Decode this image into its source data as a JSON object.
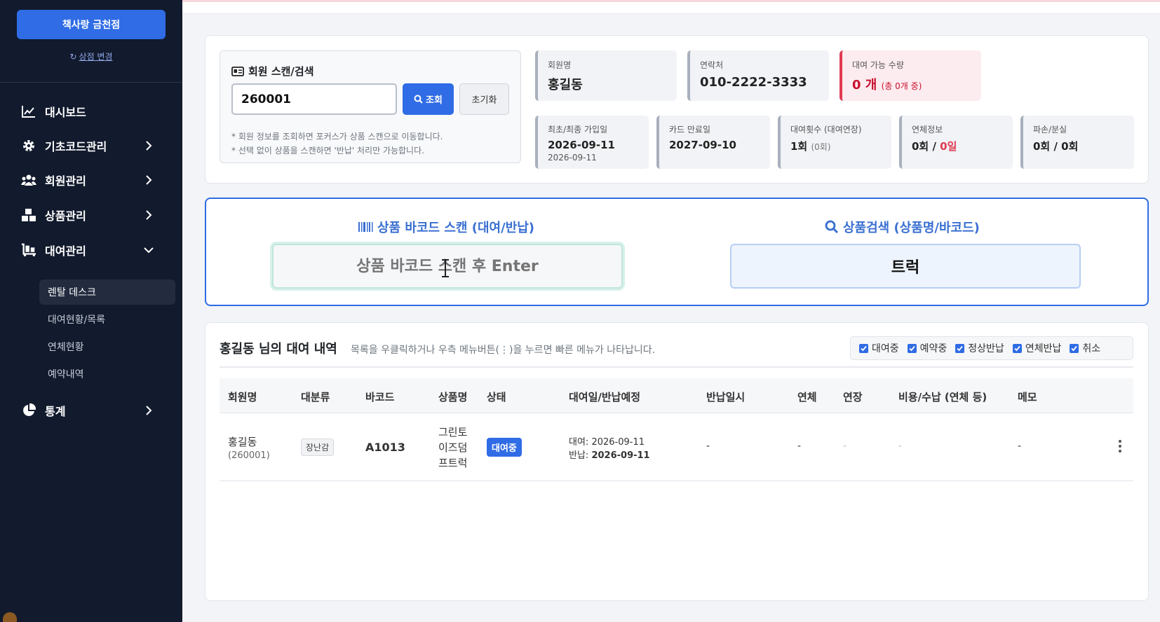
{
  "sidebar": {
    "store_button": "책사랑 금천점",
    "store_change": "상점 변경",
    "nav": [
      {
        "label": "대시보드"
      },
      {
        "label": "기초코드관리"
      },
      {
        "label": "회원관리"
      },
      {
        "label": "상품관리"
      },
      {
        "label": "대여관리"
      },
      {
        "label": "통계"
      }
    ],
    "rental_sub": [
      "렌탈 데스크",
      "대여현황/목록",
      "연체현황",
      "예약내역"
    ]
  },
  "member_scan": {
    "title": "회원 스캔/검색",
    "input_value": "260001",
    "lookup_button": "조회",
    "reset_button": "초기화",
    "note1": "* 회원 정보를 조회하면 포커스가 상품 스캔으로 이동합니다.",
    "note2": "* 선택 없이 상품을 스캔하면 '반납' 처리만 가능합니다."
  },
  "member_info": {
    "name_label": "회원명",
    "name": "홍길동",
    "phone_label": "연락처",
    "phone": "010-2222-3333",
    "avail_label": "대여 가능 수량",
    "avail_value": "0 개",
    "avail_total": "(총 0개 중)",
    "join_label": "최초/최종 가입일",
    "join_first": "2026-09-11",
    "join_last": "2026-09-11",
    "card_label": "카드 만료일",
    "card_value": "2027-09-10",
    "count_label": "대여횟수 (대여연장)",
    "count_value": "1회",
    "count_ext": "(0회)",
    "overdue_label": "연체정보",
    "overdue_count": "0회 / ",
    "overdue_days": "0일",
    "damage_label": "파손/분실",
    "damage_value": "0회 / 0회"
  },
  "scan": {
    "barcode_title": "상품 바코드 스캔 (대여/반납)",
    "barcode_placeholder": "상품 바코드 스캔 후 Enter",
    "search_title": "상품검색 (상품명/바코드)",
    "search_value": "트럭"
  },
  "history": {
    "title": "홍길동 님의 대여 내역",
    "hint": "목록을 우클릭하거나 우측 메뉴버튼(⋮)을 누르면 빠른 메뉴가 나타납니다.",
    "filters": [
      "대여중",
      "예약중",
      "정상반납",
      "연체반납",
      "취소"
    ],
    "columns": [
      "회원명",
      "대분류",
      "바코드",
      "상품명",
      "상태",
      "대여일/반납예정",
      "반납일시",
      "연체",
      "연장",
      "비용/수납 (연체 등)",
      "메모"
    ],
    "rows": [
      {
        "member": "홍길동",
        "member_no": "(260001)",
        "category": "장난감",
        "barcode": "A1013",
        "name_l1": "그린토",
        "name_l2": "이즈덤",
        "name_l3": "프트럭",
        "status": "대여중",
        "rent_label": "대여:",
        "rent_date": "2026-09-11",
        "due_label": "반납:",
        "due_date": "2026-09-11",
        "returned": "-",
        "overdue": "-",
        "extend": "-",
        "cost": "-",
        "memo": "-"
      }
    ]
  },
  "colors": {
    "sidebar_bg": "#121a2d",
    "primary": "#2f6ce5",
    "alert": "#c8102e"
  }
}
